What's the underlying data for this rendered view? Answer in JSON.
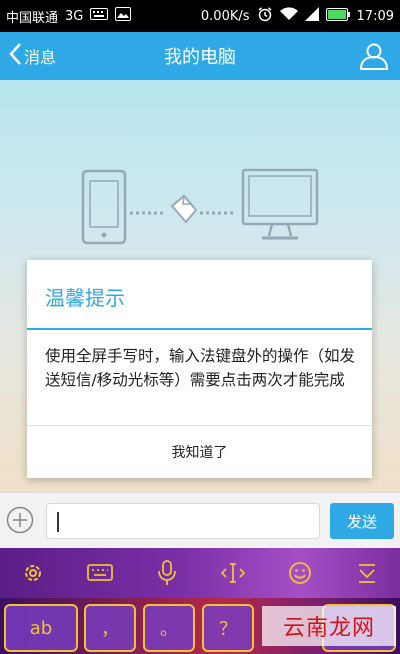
{
  "status_bar": {
    "carrier": "中国联通",
    "network": "3G",
    "speed": "0.00K/s",
    "time": "17:09"
  },
  "title_bar": {
    "back_label": "消息",
    "title": "我的电脑"
  },
  "dialog": {
    "title": "温馨提示",
    "message": "使用全屏手写时，输入法键盘外的操作（如发送短信/移动光标等）需要点击两次才能完成",
    "confirm_label": "我知道了"
  },
  "input_bar": {
    "send_label": "发送"
  },
  "keyboard": {
    "toolbar_icons": [
      "gear-icon",
      "keyboard-icon",
      "microphone-icon",
      "cursor-move-icon",
      "emoji-icon",
      "collapse-keyboard-icon"
    ],
    "keys": [
      "ab",
      "，",
      "。",
      "？"
    ]
  },
  "watermark": "云南龙网",
  "colors": {
    "accent": "#2fa9e6",
    "key_border": "#f1c233",
    "watermark": "#d3121a"
  }
}
